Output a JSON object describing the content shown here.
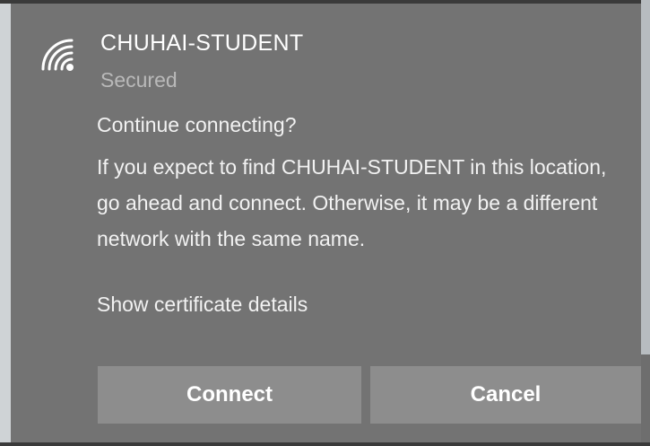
{
  "network": {
    "icon": "wifi-secured-icon",
    "name": "CHUHAI-STUDENT",
    "status": "Secured"
  },
  "dialog": {
    "prompt": "Continue connecting?",
    "message": "If you expect to find CHUHAI-STUDENT in this location, go ahead and connect. Otherwise, it may be a different network with the same name.",
    "certificate_link": "Show certificate details"
  },
  "buttons": {
    "connect_label": "Connect",
    "cancel_label": "Cancel"
  },
  "colors": {
    "panel_background": "#737373",
    "button_background": "#8d8d8d",
    "secondary_text": "#b9b9b9"
  }
}
